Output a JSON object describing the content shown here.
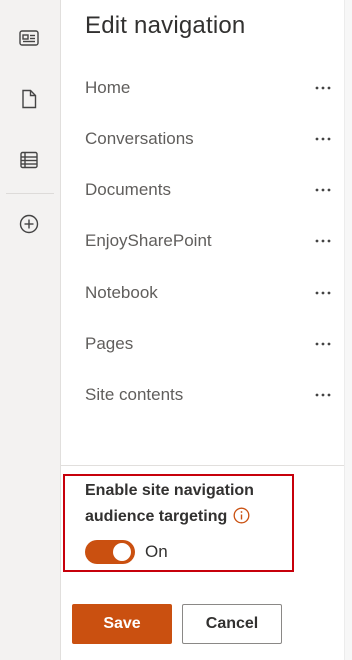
{
  "rail": {
    "icons": [
      "news-icon",
      "page-icon",
      "list-icon",
      "add-icon"
    ]
  },
  "panel": {
    "title": "Edit navigation",
    "nav_items": [
      {
        "label": "Home"
      },
      {
        "label": "Conversations"
      },
      {
        "label": "Documents"
      },
      {
        "label": "EnjoySharePoint"
      },
      {
        "label": "Notebook"
      },
      {
        "label": "Pages"
      },
      {
        "label": "Site contents"
      }
    ],
    "audience_targeting": {
      "heading_line1": "Enable site navigation",
      "heading_line2": "audience targeting",
      "toggle_state": "On",
      "enabled": true
    },
    "buttons": {
      "save_label": "Save",
      "cancel_label": "Cancel"
    }
  },
  "colors": {
    "accent": "#ca5010",
    "highlight_border": "#c7000b",
    "rail_bg": "#f3f2f1"
  }
}
